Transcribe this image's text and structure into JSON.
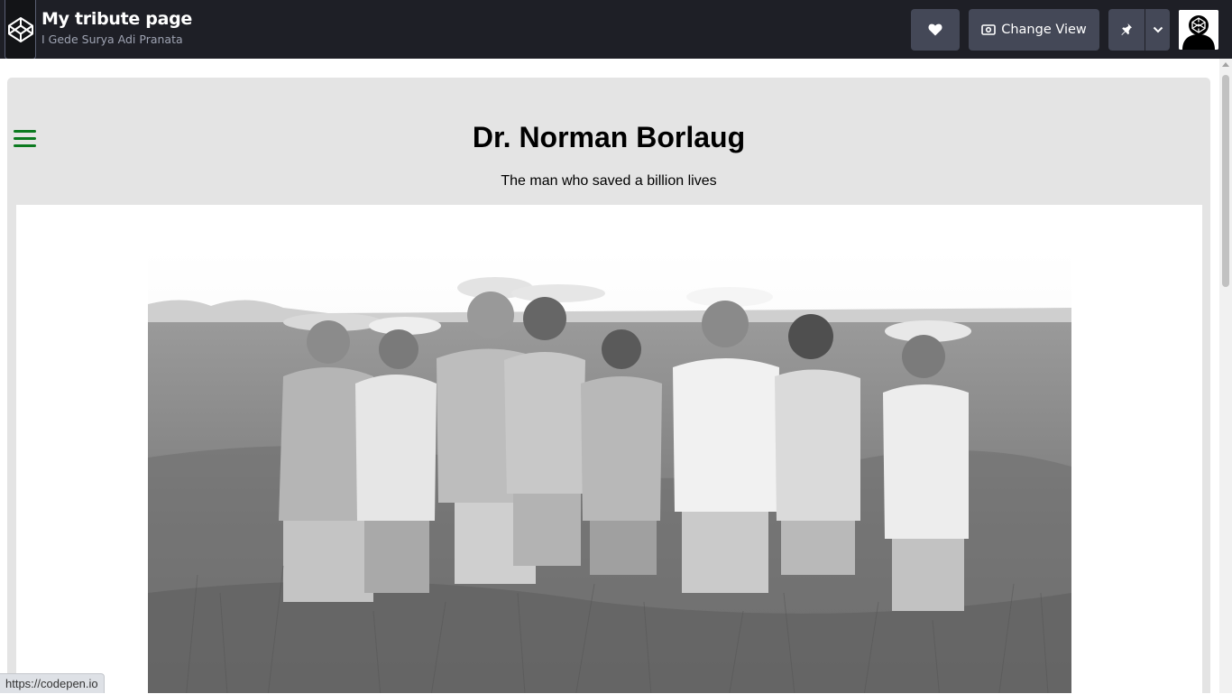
{
  "codepen": {
    "title": "My tribute page",
    "author": "I Gede Surya Adi Pranata",
    "change_view_label": "Change View",
    "icons": {
      "logo": "codepen-logo-icon",
      "heart": "heart-icon",
      "view": "change-view-icon",
      "pin": "pin-icon",
      "dropdown": "chevron-down-icon"
    }
  },
  "tribute": {
    "heading": "Dr. Norman Borlaug",
    "tagline": "The man who saved a billion lives"
  },
  "status": {
    "url": "https://codepen.io"
  },
  "colors": {
    "topbar": "#1e1f26",
    "button": "#444857",
    "panel": "#e4e4e4",
    "hamburger": "#0b7a1f"
  }
}
